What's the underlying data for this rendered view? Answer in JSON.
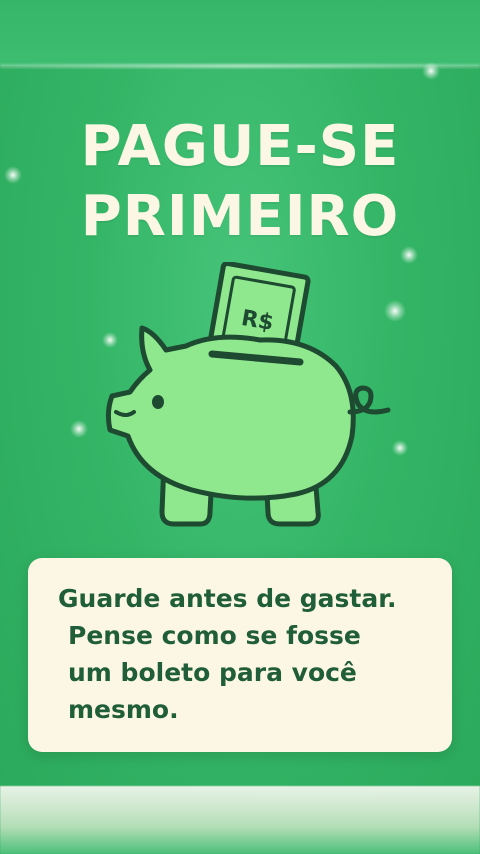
{
  "headline": {
    "line1": "PAGUE-SE",
    "line2": "PRIMEIRO"
  },
  "piggy_bank": {
    "icon": "piggy-bank-icon",
    "banknote_label": "R$"
  },
  "message": {
    "line1": "Guarde antes de gastar.",
    "line2": "Pense como se fosse",
    "line3": "um boleto para você",
    "line4": "mesmo."
  },
  "colors": {
    "background": "#34b566",
    "headline_text": "#fcf6e4",
    "card_background": "#fcf6e4",
    "card_text": "#1f5e38",
    "pig_fill": "#90e88e",
    "outline": "#1d4a30"
  }
}
